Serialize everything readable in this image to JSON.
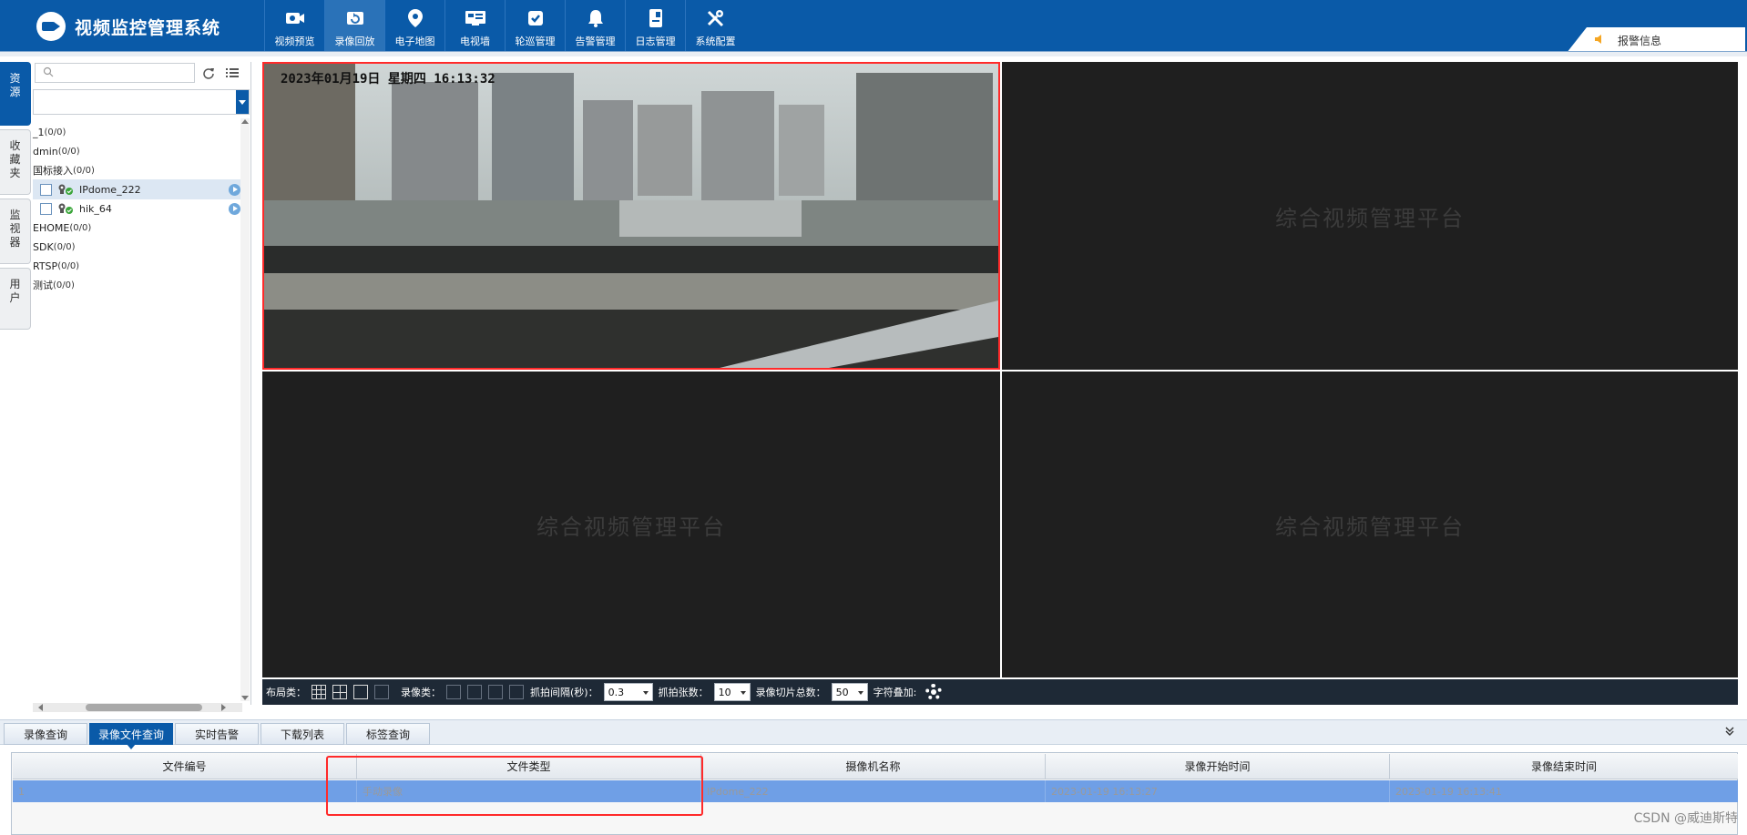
{
  "app": {
    "title": "视频监控管理系统"
  },
  "nav": {
    "items": [
      {
        "label": "视频预览",
        "icon": "camera-icon"
      },
      {
        "label": "录像回放",
        "icon": "replay-icon"
      },
      {
        "label": "电子地图",
        "icon": "map-pin-icon"
      },
      {
        "label": "电视墙",
        "icon": "tv-wall-icon"
      },
      {
        "label": "轮巡管理",
        "icon": "patrol-icon"
      },
      {
        "label": "告警管理",
        "icon": "bell-icon"
      },
      {
        "label": "日志管理",
        "icon": "log-icon"
      },
      {
        "label": "系统配置",
        "icon": "tools-icon"
      }
    ],
    "active_index": 1
  },
  "alarm": {
    "label": "报警信息"
  },
  "side_tabs": [
    {
      "label": "资源"
    },
    {
      "label": "收藏夹"
    },
    {
      "label": "监视器"
    },
    {
      "label": "用户"
    }
  ],
  "search": {
    "placeholder": ""
  },
  "tree": {
    "nodes": [
      {
        "name": "_1",
        "count": "(0/0)"
      },
      {
        "name": "dmin",
        "count": "(0/0)"
      },
      {
        "name": "国标接入",
        "count": "(0/0)"
      },
      {
        "name": "IPdome_222",
        "count": ""
      },
      {
        "name": "hik_64",
        "count": ""
      },
      {
        "name": "EHOME",
        "count": "(0/0)"
      },
      {
        "name": "SDK",
        "count": "(0/0)"
      },
      {
        "name": "RTSP",
        "count": "(0/0)"
      },
      {
        "name": "测试",
        "count": "(0/0)"
      }
    ]
  },
  "video": {
    "osd": "2023年01月19日  星期四  16:13:32",
    "placeholder": "综合视频管理平台"
  },
  "toolbar": {
    "layout_label": "布局类：",
    "record_label": "录像类：",
    "interval_label": "抓拍间隔(秒)：",
    "interval_value": "0.3",
    "count_label": "抓拍张数：",
    "count_value": "10",
    "slice_label": "录像切片总数：",
    "slice_value": "50",
    "overlay_label": "字符叠加:"
  },
  "bottom_tabs": {
    "items": [
      {
        "label": "录像查询"
      },
      {
        "label": "录像文件查询"
      },
      {
        "label": "实时告警"
      },
      {
        "label": "下载列表"
      },
      {
        "label": "标签查询"
      }
    ],
    "active_index": 1
  },
  "table": {
    "columns": [
      "文件编号",
      "文件类型",
      "摄像机名称",
      "录像开始时间",
      "录像结束时间"
    ],
    "rows": [
      [
        "1",
        "手动录像",
        "IPdome_222",
        "2023-01-19 16:13:27",
        "2023-01-19 16:13:41"
      ]
    ]
  },
  "watermark": "CSDN @威迪斯特",
  "colors": {
    "brand": "#0a5aa8",
    "highlight": "#ff2a2a",
    "selected_row": "#6f9fe6"
  }
}
